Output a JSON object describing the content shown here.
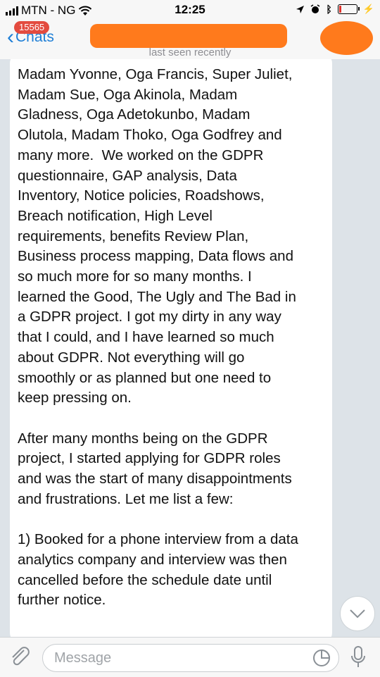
{
  "status_bar": {
    "carrier": "MTN - NG",
    "time": "12:25",
    "battery_level": 0.12
  },
  "nav": {
    "back_label": "Chats",
    "unread_count": "15565",
    "last_seen": "last seen recently"
  },
  "message": {
    "text": "Madam Yvonne, Oga Francis, Super Juliet,\nMadam Sue, Oga Akinola, Madam\nGladness, Oga Adetokunbo, Madam\nOlutola, Madam Thoko, Oga Godfrey and\nmany more.  We worked on the GDPR\nquestionnaire, GAP analysis, Data\nInventory, Notice policies, Roadshows,\nBreach notification, High Level\nrequirements, benefits Review Plan,\nBusiness process mapping, Data flows and\nso much more for so many months. I\nlearned the Good, The Ugly and The Bad in\na GDPR project. I got my dirty in any way\nthat I could, and I have learned so much\nabout GDPR. Not everything will go\nsmoothly or as planned but one need to\nkeep pressing on.\n\nAfter many months being on the GDPR\nproject, I started applying for GDPR roles\nand was the start of many disappointments\nand frustrations. Let me list a few:\n\n1) Booked for a phone interview from a data\nanalytics company and interview was then\ncancelled before the schedule date until\nfurther notice."
  },
  "input": {
    "placeholder": "Message"
  },
  "colors": {
    "accent": "#1f7fd6",
    "badge": "#e34b3f",
    "redaction": "#ff7a1c"
  }
}
